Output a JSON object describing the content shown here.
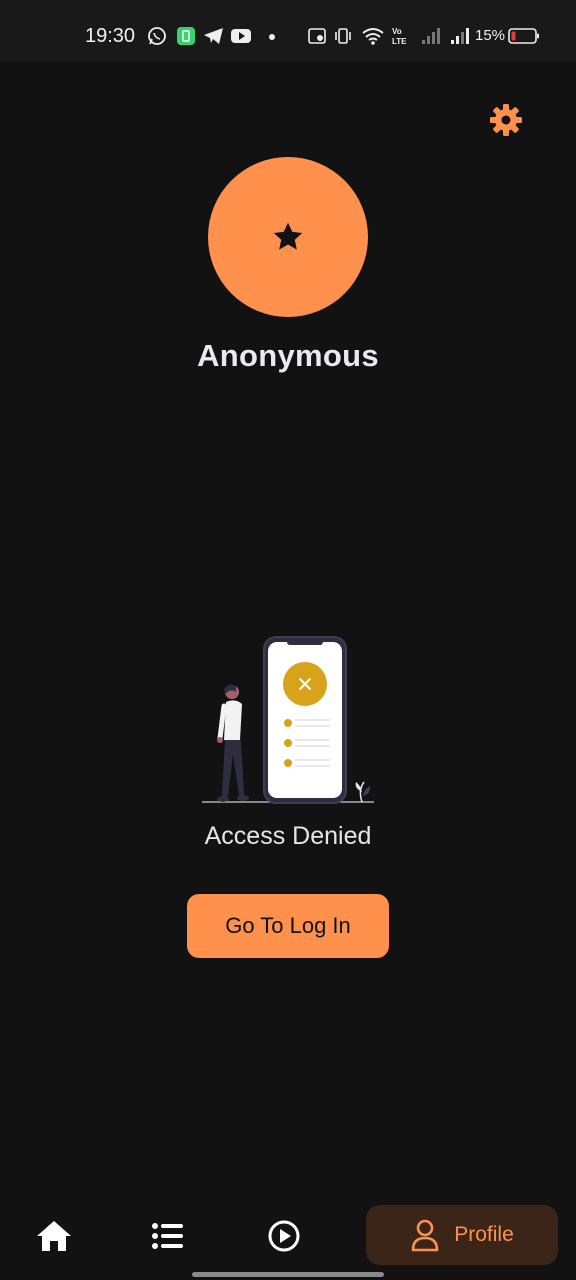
{
  "status_bar": {
    "time": "19:30",
    "battery_percent": "15%",
    "icons": [
      "whatsapp-icon",
      "battery-saver-icon",
      "telegram-icon",
      "youtube-icon",
      "dot-icon",
      "screen-record-icon",
      "vibrate-icon",
      "wifi-icon",
      "volte-icon",
      "signal-icon",
      "signal-icon",
      "battery-icon"
    ]
  },
  "profile": {
    "username": "Anonymous",
    "avatar_icon": "star-icon",
    "avatar_color": "#ff914d"
  },
  "access": {
    "message": "Access Denied",
    "login_button_label": "Go To Log In"
  },
  "bottom_nav": {
    "items": [
      {
        "icon": "home-icon"
      },
      {
        "icon": "list-icon"
      },
      {
        "icon": "play-circle-icon"
      },
      {
        "icon": "person-icon",
        "label": "Profile",
        "active": true
      }
    ]
  },
  "colors": {
    "accent": "#ff914d",
    "background": "#121212",
    "active_nav_bg": "#3a2518"
  }
}
